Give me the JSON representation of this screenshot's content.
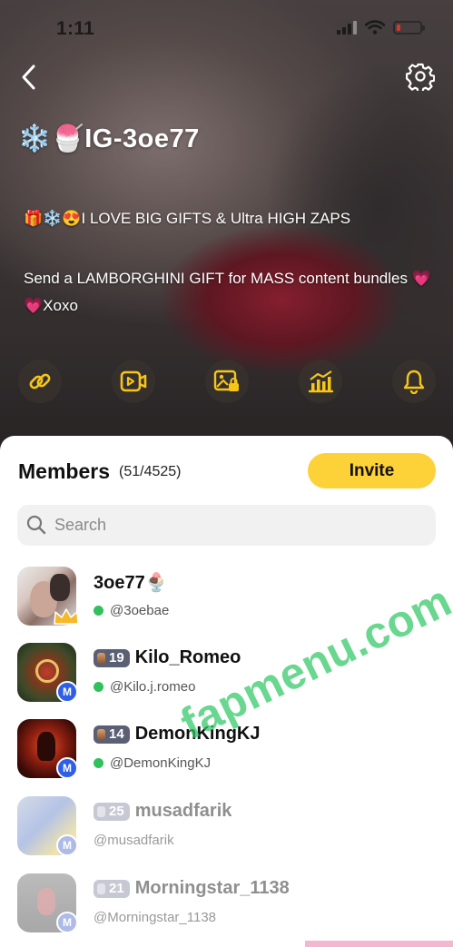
{
  "status_bar": {
    "time": "1:11",
    "battery_level": 0.15,
    "battery_color": "#e2312c"
  },
  "header": {
    "profile_name": "❄️🍧IG-3oe77",
    "bio_line1": "🎁❄️😍I LOVE BIG GIFTS & Ultra HIGH ZAPS",
    "bio_line2": "Send a LAMBORGHINI GIFT for MASS content bundles 💗💗Xoxo",
    "action_icons": [
      "link-icon",
      "video-icon",
      "locked-photo-icon",
      "stats-icon",
      "bell-icon"
    ]
  },
  "members": {
    "title": "Members",
    "count": "(51/4525)",
    "invite_label": "Invite",
    "search_placeholder": "Search",
    "list": [
      {
        "name": "3oe77🍨",
        "handle": "@3oebae",
        "level": null,
        "online": true,
        "badge": "crown",
        "faded": false
      },
      {
        "name": "Kilo_Romeo",
        "handle": "@Kilo.j.romeo",
        "level": "19",
        "online": true,
        "badge": "M",
        "faded": false
      },
      {
        "name": "DemonKingKJ",
        "handle": "@DemonKingKJ",
        "level": "14",
        "online": true,
        "badge": "M",
        "faded": false
      },
      {
        "name": "musadfarik",
        "handle": "@musadfarik",
        "level": "25",
        "online": false,
        "badge": "M",
        "faded": true
      },
      {
        "name": "Morningstar_1138",
        "handle": "@Morningstar_1138",
        "level": "21",
        "online": false,
        "badge": "M",
        "faded": true
      }
    ]
  },
  "watermark": "fapmenu.com",
  "colors": {
    "accent": "#fdd138",
    "online": "#2fc25b",
    "member_badge": "#2f5fe8"
  }
}
